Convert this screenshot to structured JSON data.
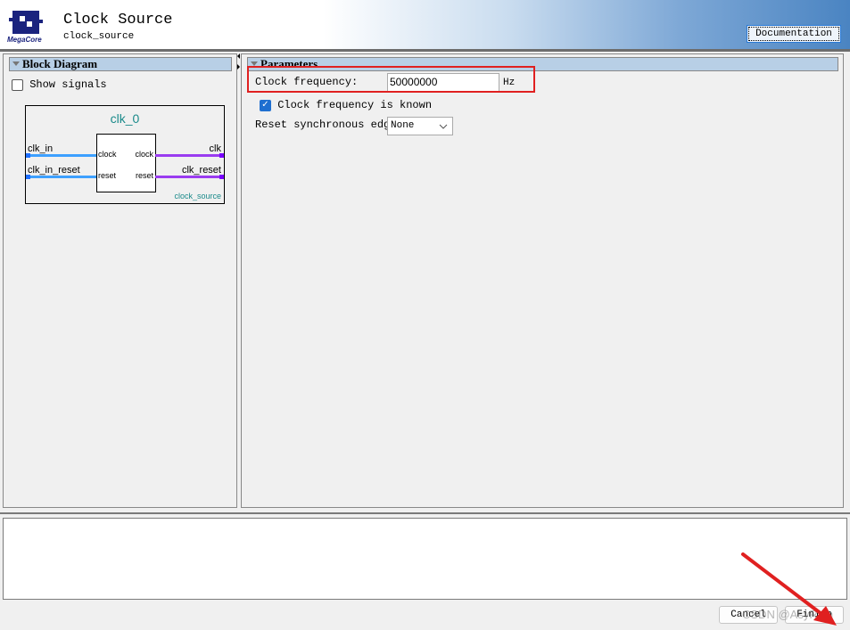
{
  "header": {
    "logo_text": "MegaCore",
    "title": "Clock Source",
    "subtitle": "clock_source",
    "documentation_label": "Documentation"
  },
  "left_panel": {
    "title": "Block Diagram",
    "show_signals_label": "Show signals",
    "show_signals_checked": false,
    "diagram": {
      "instance_name": "clk_0",
      "module_name": "clock_source",
      "inputs": [
        {
          "external": "clk_in",
          "port": "clock"
        },
        {
          "external": "clk_in_reset",
          "port": "reset"
        }
      ],
      "outputs": [
        {
          "external": "clk",
          "port": "clock"
        },
        {
          "external": "clk_reset",
          "port": "reset"
        }
      ],
      "input_color": "#1e90ff",
      "output_color": "#8a2be2"
    }
  },
  "right_panel": {
    "title": "Parameters",
    "clock_frequency_label": "Clock frequency:",
    "clock_frequency_value": "50000000",
    "clock_frequency_unit": "Hz",
    "known_label": "Clock frequency is known",
    "known_checked": true,
    "reset_label": "Reset synchronous edges:",
    "reset_value": "None"
  },
  "footer": {
    "cancel_label": "Cancel",
    "finish_label": "Finish",
    "watermark": "CSDN @AsyRain"
  },
  "annotation_color": "#e02020"
}
